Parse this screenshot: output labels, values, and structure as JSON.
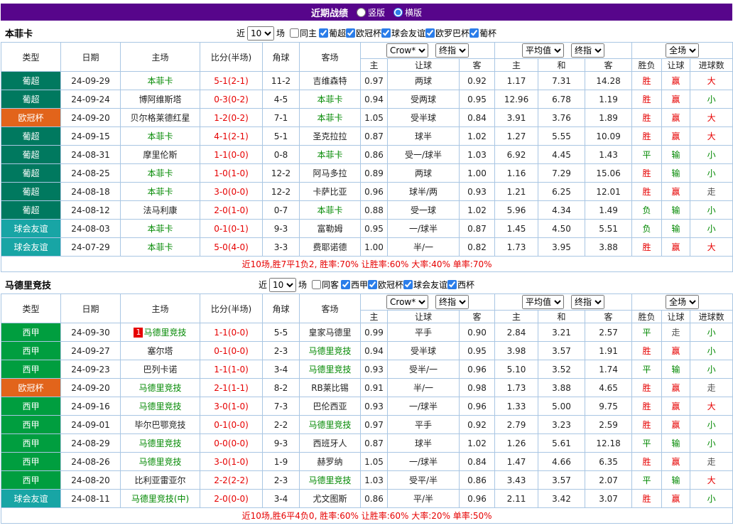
{
  "colors": {
    "topbar_bg": "#57058b",
    "accent_blue": "#2b7de9",
    "border": "#a9c6e3",
    "red": "#e60000",
    "green": "#008800",
    "gray": "#555555",
    "league": {
      "葡超": "#00795f",
      "欧冠杯": "#e2641b",
      "球会友谊": "#18a5a5",
      "西甲": "#009e3f"
    },
    "result": {
      "胜": "#e60000",
      "赢": "#e60000",
      "大": "#e60000",
      "平": "#008800",
      "负": "#008800",
      "输": "#008800",
      "小": "#008800",
      "走": "#555555"
    }
  },
  "topbar": {
    "title": "近期战绩",
    "radios": [
      {
        "label": "竖版",
        "checked": false
      },
      {
        "label": "横版",
        "checked": true
      }
    ]
  },
  "filter": {
    "near": "近",
    "count": "10",
    "unit": "场"
  },
  "table_header": {
    "type": "类型",
    "date": "日期",
    "home": "主场",
    "score": "比分(半场)",
    "corner": "角球",
    "away": "客场",
    "crow_select": "Crow*",
    "crow_index_select": "终指",
    "avg_select": "平均值",
    "avg_index_select": "终指",
    "full_select": "全场",
    "sub_crow": [
      "主",
      "让球",
      "客"
    ],
    "sub_avg": [
      "主",
      "和",
      "客"
    ],
    "sub_full": [
      "胜负",
      "让球",
      "进球数"
    ]
  },
  "sections": [
    {
      "team": "本菲卡",
      "same_side_label": "同主",
      "same_side_checked": false,
      "leagues": [
        {
          "label": "葡超",
          "checked": true
        },
        {
          "label": "欧冠杯",
          "checked": true
        },
        {
          "label": "球会友谊",
          "checked": true
        },
        {
          "label": "欧罗巴杯",
          "checked": true
        },
        {
          "label": "葡杯",
          "checked": true
        }
      ],
      "rows": [
        {
          "league": "葡超",
          "date": "24-09-29",
          "home": "本菲卡",
          "away": "吉维森特",
          "focus": "home",
          "rank": "",
          "score": "5-1(2-1)",
          "corner": "11-2",
          "odds": [
            "0.97",
            "两球",
            "0.92"
          ],
          "avg": [
            "1.17",
            "7.31",
            "14.28"
          ],
          "results": [
            "胜",
            "赢",
            "大"
          ]
        },
        {
          "league": "葡超",
          "date": "24-09-24",
          "home": "博阿维斯塔",
          "away": "本菲卡",
          "focus": "away",
          "rank": "",
          "score": "0-3(0-2)",
          "corner": "4-5",
          "odds": [
            "0.94",
            "受两球",
            "0.95"
          ],
          "avg": [
            "12.96",
            "6.78",
            "1.19"
          ],
          "results": [
            "胜",
            "赢",
            "小"
          ]
        },
        {
          "league": "欧冠杯",
          "date": "24-09-20",
          "home": "贝尔格莱德红星",
          "away": "本菲卡",
          "focus": "away",
          "rank": "",
          "score": "1-2(0-2)",
          "corner": "7-1",
          "odds": [
            "1.05",
            "受半球",
            "0.84"
          ],
          "avg": [
            "3.91",
            "3.76",
            "1.89"
          ],
          "results": [
            "胜",
            "赢",
            "大"
          ]
        },
        {
          "league": "葡超",
          "date": "24-09-15",
          "home": "本菲卡",
          "away": "圣克拉拉",
          "focus": "home",
          "rank": "",
          "score": "4-1(2-1)",
          "corner": "5-1",
          "odds": [
            "0.87",
            "球半",
            "1.02"
          ],
          "avg": [
            "1.27",
            "5.55",
            "10.09"
          ],
          "results": [
            "胜",
            "赢",
            "大"
          ]
        },
        {
          "league": "葡超",
          "date": "24-08-31",
          "home": "摩里伦斯",
          "away": "本菲卡",
          "focus": "away",
          "rank": "",
          "score": "1-1(0-0)",
          "corner": "0-8",
          "odds": [
            "0.86",
            "受一/球半",
            "1.03"
          ],
          "avg": [
            "6.92",
            "4.45",
            "1.43"
          ],
          "results": [
            "平",
            "输",
            "小"
          ]
        },
        {
          "league": "葡超",
          "date": "24-08-25",
          "home": "本菲卡",
          "away": "阿马多拉",
          "focus": "home",
          "rank": "",
          "score": "1-0(1-0)",
          "corner": "12-2",
          "odds": [
            "0.89",
            "两球",
            "1.00"
          ],
          "avg": [
            "1.16",
            "7.29",
            "15.06"
          ],
          "results": [
            "胜",
            "输",
            "小"
          ]
        },
        {
          "league": "葡超",
          "date": "24-08-18",
          "home": "本菲卡",
          "away": "卡萨比亚",
          "focus": "home",
          "rank": "",
          "score": "3-0(0-0)",
          "corner": "12-2",
          "odds": [
            "0.96",
            "球半/两",
            "0.93"
          ],
          "avg": [
            "1.21",
            "6.25",
            "12.01"
          ],
          "results": [
            "胜",
            "赢",
            "走"
          ]
        },
        {
          "league": "葡超",
          "date": "24-08-12",
          "home": "法马利康",
          "away": "本菲卡",
          "focus": "away",
          "rank": "",
          "score": "2-0(1-0)",
          "corner": "0-7",
          "odds": [
            "0.88",
            "受一球",
            "1.02"
          ],
          "avg": [
            "5.96",
            "4.34",
            "1.49"
          ],
          "results": [
            "负",
            "输",
            "小"
          ]
        },
        {
          "league": "球会友谊",
          "date": "24-08-03",
          "home": "本菲卡",
          "away": "富勒姆",
          "focus": "home",
          "rank": "",
          "score": "0-1(0-1)",
          "corner": "9-3",
          "odds": [
            "0.95",
            "一/球半",
            "0.87"
          ],
          "avg": [
            "1.45",
            "4.50",
            "5.51"
          ],
          "results": [
            "负",
            "输",
            "小"
          ]
        },
        {
          "league": "球会友谊",
          "date": "24-07-29",
          "home": "本菲卡",
          "away": "费耶诺德",
          "focus": "home",
          "rank": "",
          "score": "5-0(4-0)",
          "corner": "3-3",
          "odds": [
            "1.00",
            "半/一",
            "0.82"
          ],
          "avg": [
            "1.73",
            "3.95",
            "3.88"
          ],
          "results": [
            "胜",
            "赢",
            "大"
          ]
        }
      ],
      "summary": "近10场,胜7平1负2, 胜率:70% 让胜率:60% 大率:40% 单率:70%"
    },
    {
      "team": "马德里竞技",
      "same_side_label": "同客",
      "same_side_checked": false,
      "leagues": [
        {
          "label": "西甲",
          "checked": true
        },
        {
          "label": "欧冠杯",
          "checked": true
        },
        {
          "label": "球会友谊",
          "checked": true
        },
        {
          "label": "西杯",
          "checked": true
        }
      ],
      "rows": [
        {
          "league": "西甲",
          "date": "24-09-30",
          "home": "马德里竞技",
          "away": "皇家马德里",
          "focus": "home",
          "rank": "1",
          "score": "1-1(0-0)",
          "corner": "5-5",
          "odds": [
            "0.99",
            "平手",
            "0.90"
          ],
          "avg": [
            "2.84",
            "3.21",
            "2.57"
          ],
          "results": [
            "平",
            "走",
            "小"
          ]
        },
        {
          "league": "西甲",
          "date": "24-09-27",
          "home": "塞尔塔",
          "away": "马德里竞技",
          "focus": "away",
          "rank": "",
          "score": "0-1(0-0)",
          "corner": "2-3",
          "odds": [
            "0.94",
            "受半球",
            "0.95"
          ],
          "avg": [
            "3.98",
            "3.57",
            "1.91"
          ],
          "results": [
            "胜",
            "赢",
            "小"
          ]
        },
        {
          "league": "西甲",
          "date": "24-09-23",
          "home": "巴列卡诺",
          "away": "马德里竞技",
          "focus": "away",
          "rank": "",
          "score": "1-1(1-0)",
          "corner": "3-4",
          "odds": [
            "0.93",
            "受半/一",
            "0.96"
          ],
          "avg": [
            "5.10",
            "3.52",
            "1.74"
          ],
          "results": [
            "平",
            "输",
            "小"
          ]
        },
        {
          "league": "欧冠杯",
          "date": "24-09-20",
          "home": "马德里竞技",
          "away": "RB莱比锡",
          "focus": "home",
          "rank": "",
          "score": "2-1(1-1)",
          "corner": "8-2",
          "odds": [
            "0.91",
            "半/一",
            "0.98"
          ],
          "avg": [
            "1.73",
            "3.88",
            "4.65"
          ],
          "results": [
            "胜",
            "赢",
            "走"
          ]
        },
        {
          "league": "西甲",
          "date": "24-09-16",
          "home": "马德里竞技",
          "away": "巴伦西亚",
          "focus": "home",
          "rank": "",
          "score": "3-0(1-0)",
          "corner": "7-3",
          "odds": [
            "0.93",
            "一/球半",
            "0.96"
          ],
          "avg": [
            "1.33",
            "5.00",
            "9.75"
          ],
          "results": [
            "胜",
            "赢",
            "大"
          ]
        },
        {
          "league": "西甲",
          "date": "24-09-01",
          "home": "毕尔巴鄂竞技",
          "away": "马德里竞技",
          "focus": "away",
          "rank": "",
          "score": "0-1(0-0)",
          "corner": "2-2",
          "odds": [
            "0.97",
            "平手",
            "0.92"
          ],
          "avg": [
            "2.79",
            "3.23",
            "2.59"
          ],
          "results": [
            "胜",
            "赢",
            "小"
          ]
        },
        {
          "league": "西甲",
          "date": "24-08-29",
          "home": "马德里竞技",
          "away": "西班牙人",
          "focus": "home",
          "rank": "",
          "score": "0-0(0-0)",
          "corner": "9-3",
          "odds": [
            "0.87",
            "球半",
            "1.02"
          ],
          "avg": [
            "1.26",
            "5.61",
            "12.18"
          ],
          "results": [
            "平",
            "输",
            "小"
          ]
        },
        {
          "league": "西甲",
          "date": "24-08-26",
          "home": "马德里竞技",
          "away": "赫罗纳",
          "focus": "home",
          "rank": "",
          "score": "3-0(1-0)",
          "corner": "1-9",
          "odds": [
            "1.05",
            "一/球半",
            "0.84"
          ],
          "avg": [
            "1.47",
            "4.66",
            "6.35"
          ],
          "results": [
            "胜",
            "赢",
            "走"
          ]
        },
        {
          "league": "西甲",
          "date": "24-08-20",
          "home": "比利亚雷亚尔",
          "away": "马德里竞技",
          "focus": "away",
          "rank": "",
          "score": "2-2(2-2)",
          "corner": "2-3",
          "odds": [
            "1.03",
            "受平/半",
            "0.86"
          ],
          "avg": [
            "3.43",
            "3.57",
            "2.07"
          ],
          "results": [
            "平",
            "输",
            "大"
          ]
        },
        {
          "league": "球会友谊",
          "date": "24-08-11",
          "home": "马德里竞技(中)",
          "away": "尤文图斯",
          "focus": "home",
          "rank": "",
          "score": "2-0(0-0)",
          "corner": "3-4",
          "odds": [
            "0.86",
            "平/半",
            "0.96"
          ],
          "avg": [
            "2.11",
            "3.42",
            "3.07"
          ],
          "results": [
            "胜",
            "赢",
            "小"
          ]
        }
      ],
      "summary": "近10场,胜6平4负0, 胜率:60% 让胜率:60% 大率:20% 单率:50%"
    }
  ]
}
